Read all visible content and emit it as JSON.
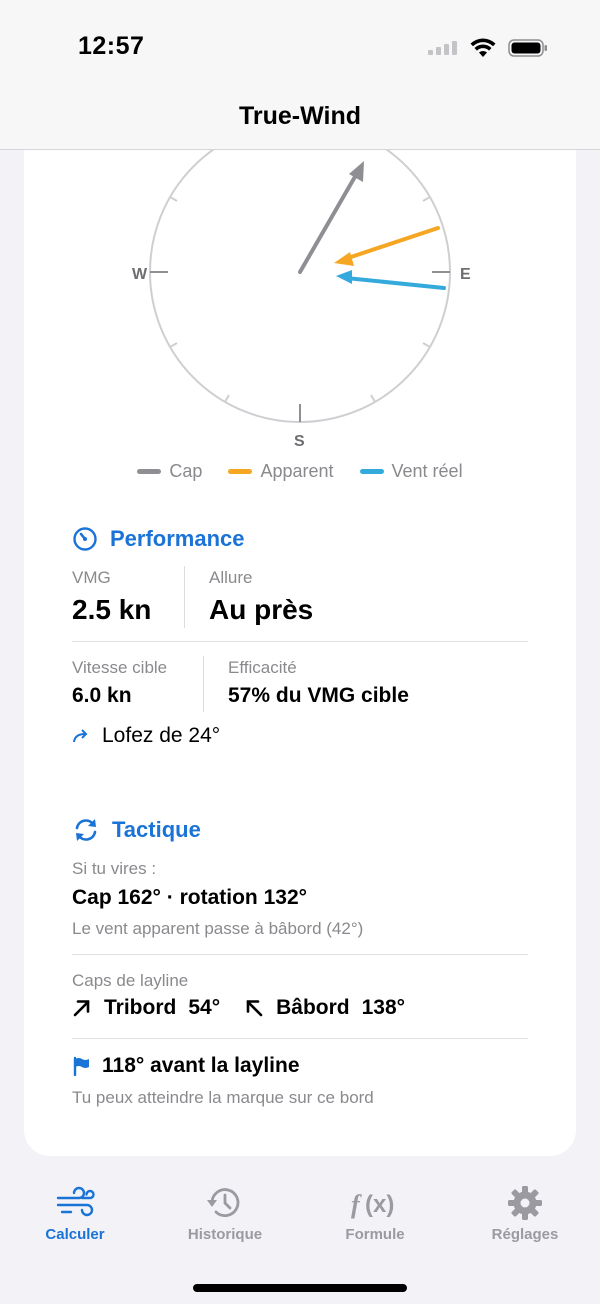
{
  "status_bar": {
    "time": "12:57"
  },
  "nav": {
    "title": "True-Wind"
  },
  "compass": {
    "west_label": "W",
    "east_label": "E",
    "south_label": "S",
    "heading_deg": 30,
    "apparent_deg": 70,
    "true_wind_deg": 96
  },
  "legend": {
    "items": [
      {
        "label": "Cap",
        "color": "#8e8e93"
      },
      {
        "label": "Apparent",
        "color": "#f5a623"
      },
      {
        "label": "Vent réel",
        "color": "#34aadc"
      }
    ]
  },
  "performance": {
    "title": "Performance",
    "vmg_label": "VMG",
    "vmg_value": "2.5 kn",
    "allure_label": "Allure",
    "allure_value": "Au près",
    "target_speed_label": "Vitesse cible",
    "target_speed_value": "6.0 kn",
    "efficiency_label": "Efficacité",
    "efficiency_value": "57% du VMG cible",
    "hint": "Lofez de 24°"
  },
  "tactique": {
    "title": "Tactique",
    "tack_label": "Si tu vires :",
    "tack_value": "Cap 162° · rotation 132°",
    "tack_note": "Le vent apparent passe à bâbord (42°)",
    "layline_label": "Caps de layline",
    "starboard_label": "Tribord",
    "starboard_value": "54°",
    "port_label": "Bâbord",
    "port_value": "138°",
    "layline_distance": "118° avant la layline",
    "layline_note": "Tu peux atteindre la marque sur ce bord"
  },
  "colors": {
    "accent": "#1a73d6",
    "heading": "#8e8e93",
    "apparent": "#f5a623",
    "true_wind": "#34aadc"
  },
  "tabs": [
    {
      "label": "Calculer",
      "icon": "wind-icon",
      "active": true
    },
    {
      "label": "Historique",
      "icon": "history-clock-icon",
      "active": false
    },
    {
      "label": "Formule",
      "icon": "function-icon",
      "active": false
    },
    {
      "label": "Réglages",
      "icon": "gear-icon",
      "active": false
    }
  ]
}
